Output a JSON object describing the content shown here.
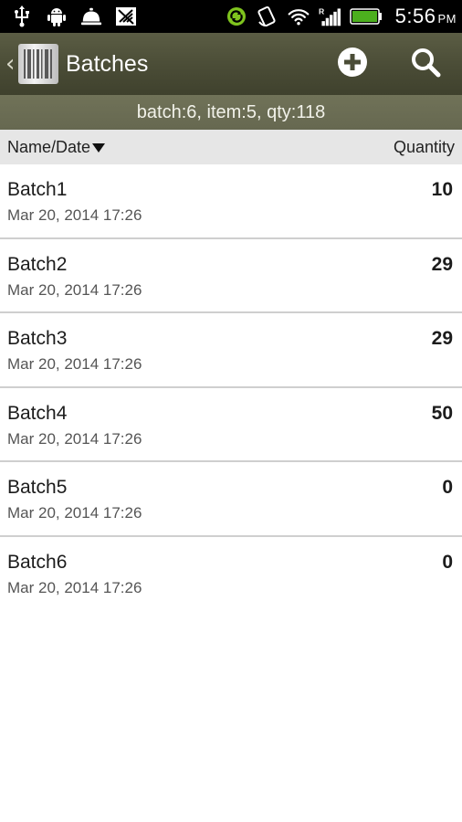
{
  "status_bar": {
    "icons_left": [
      "usb-icon",
      "android-debug-icon",
      "notification-bell-icon",
      "no-signal-notification-icon"
    ],
    "icons_right": [
      "sync-icon",
      "rotation-lock-icon",
      "wifi-icon",
      "signal-icon",
      "battery-icon"
    ],
    "time": "5:56",
    "ampm": "PM"
  },
  "action_bar": {
    "title": "Batches",
    "up_indicator": "‹",
    "add_icon": "add-circle-icon",
    "search_icon": "search-icon"
  },
  "summary": {
    "text": "batch:6, item:5, qty:118"
  },
  "columns": {
    "name_date": "Name/Date",
    "quantity": "Quantity"
  },
  "batches": [
    {
      "name": "Batch1",
      "date": "Mar 20, 2014 17:26",
      "qty": "10"
    },
    {
      "name": "Batch2",
      "date": "Mar 20, 2014 17:26",
      "qty": "29"
    },
    {
      "name": "Batch3",
      "date": "Mar 20, 2014 17:26",
      "qty": "29"
    },
    {
      "name": "Batch4",
      "date": "Mar 20, 2014 17:26",
      "qty": "50"
    },
    {
      "name": "Batch5",
      "date": "Mar 20, 2014 17:26",
      "qty": "0"
    },
    {
      "name": "Batch6",
      "date": "Mar 20, 2014 17:26",
      "qty": "0"
    }
  ],
  "colors": {
    "action_bar": "#4a4c36",
    "summary_bar": "#6b6d54",
    "header_bg": "#e6e6e6",
    "battery_fill": "#4caf1e"
  }
}
